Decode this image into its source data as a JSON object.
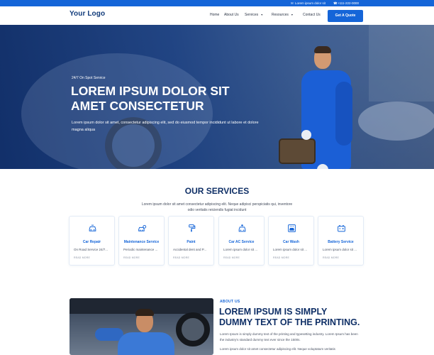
{
  "topbar": {
    "email": "Lorem ipsum dolor sit",
    "phone": "+111-222-0000"
  },
  "header": {
    "logo": "Your Logo",
    "nav": {
      "home": "Home",
      "about": "About Us",
      "services": "Services",
      "resources": "Resources",
      "contact": "Contact Us"
    },
    "cta": "Get A Quote"
  },
  "hero": {
    "tag": "24/7 On Spot Service",
    "title": "LOREM IPSUM DOLOR SIT AMET CONSECTETUR",
    "description": "Lorem ipsum dolor sit amet, consectetur adipiscing elit, sed do eiusmod tempor incididunt ut labore et dolore magna aliqua"
  },
  "services": {
    "title": "OUR SERVICES",
    "description": "Lorem ipsum dolor sit amet consectetur adipiscing elit. Neque adipisci perspiciatis qui, inventore odio veritatis reiciendis fugiat incidunt",
    "items": [
      {
        "title": "Car Repair",
        "text": "On Road Service 24/7...",
        "more": "READ MORE",
        "icon": "car-repair-icon"
      },
      {
        "title": "Maintenance Service",
        "text": "Periodic maintenance ...",
        "more": "READ MORE",
        "icon": "maintenance-icon"
      },
      {
        "title": "Paint",
        "text": "Accidental dent and P...",
        "more": "READ MORE",
        "icon": "paint-icon"
      },
      {
        "title": "Car AC Service",
        "text": "Lorem ipsum dolor sit ...",
        "more": "READ MORE",
        "icon": "car-ac-icon"
      },
      {
        "title": "Car Wash",
        "text": "Lorem ipsum dolor sit ...",
        "more": "READ MORE",
        "icon": "car-wash-icon"
      },
      {
        "title": "Battery Service",
        "text": "Lorem ipsum dolor sit ...",
        "more": "READ MORE",
        "icon": "battery-icon"
      }
    ]
  },
  "about": {
    "tag": "ABOUT US",
    "title": "LOREM IPSUM IS SIMPLY DUMMY TEXT OF THE PRINTING.",
    "p1": "Lorem Ipsum is simply dummy text of the printing and typesetting industry. Lorem Ipsum has been the industry's standard dummy text ever since the 1500s.",
    "p2": "Lorem ipsum dolor sit amet consectetur adipiscing elit. Neque voluptatum veritatis"
  },
  "colors": {
    "primary": "#1565d8",
    "heading": "#0f2f66",
    "hero_overlay": "#0e2d69"
  }
}
